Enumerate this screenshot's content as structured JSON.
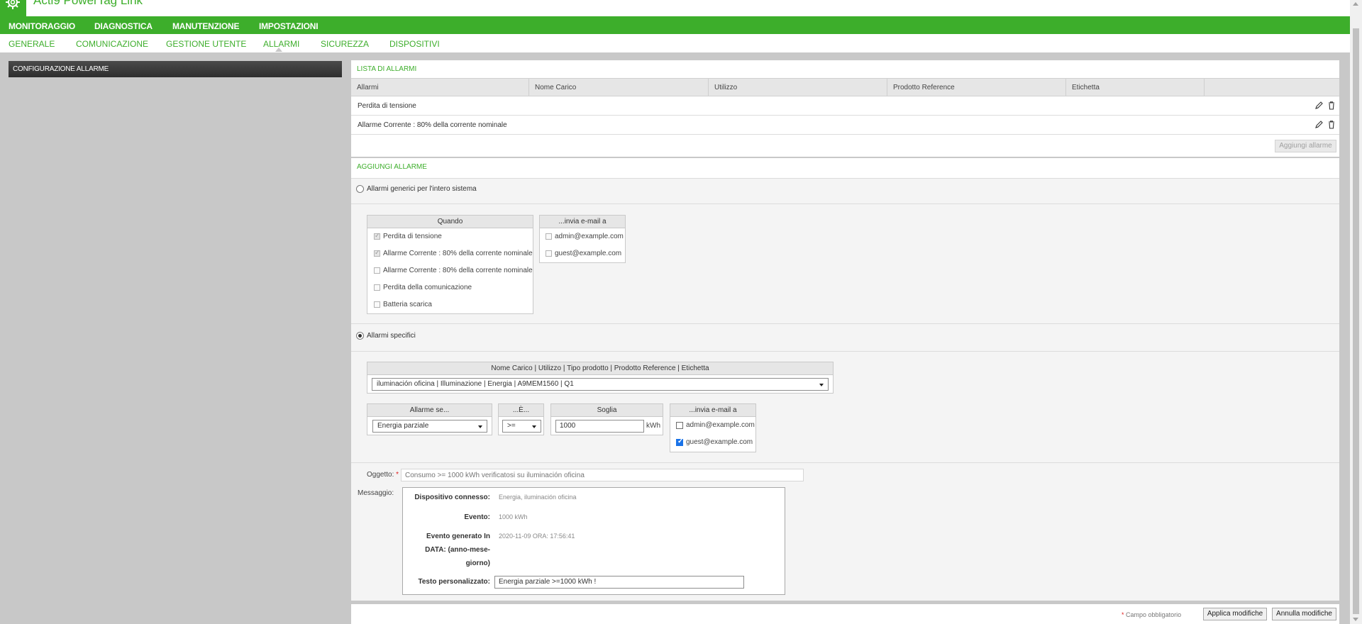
{
  "app": {
    "title": "Acti9 PowerTag Link",
    "logo_icon": "gear-icon"
  },
  "main_nav": [
    {
      "label": "MONITORAGGIO"
    },
    {
      "label": "DIAGNOSTICA"
    },
    {
      "label": "MANUTENZIONE"
    },
    {
      "label": "IMPOSTAZIONI",
      "active": true
    }
  ],
  "sub_nav": [
    {
      "label": "GENERALE"
    },
    {
      "label": "COMUNICAZIONE"
    },
    {
      "label": "GESTIONE UTENTE"
    },
    {
      "label": "ALLARMI",
      "active": true
    },
    {
      "label": "SICUREZZA"
    },
    {
      "label": "DISPOSITIVI"
    }
  ],
  "left_panel": {
    "title": "CONFIGURAZIONE ALLARME"
  },
  "alarm_list": {
    "title": "LISTA DI ALLARMI",
    "columns": [
      "Allarmi",
      "Nome Carico",
      "Utilizzo",
      "Prodotto Reference",
      "Etichetta"
    ],
    "rows": [
      {
        "alarm": "Perdita di tensione"
      },
      {
        "alarm": "Allarme Corrente : 80% della corrente nominale"
      }
    ],
    "add_button": "Aggiungi allarme"
  },
  "add_alarm": {
    "title": "AGGIUNGI ALLARME",
    "generic_radio": "Allarmi generici per l'intero sistema",
    "generic_when": {
      "header": "Quando",
      "options": [
        "Perdita di tensione",
        "Allarme Corrente : 80% della corrente nominale",
        "Allarme Corrente : 80% della corrente nominale",
        "Perdita della comunicazione",
        "Batteria scarica"
      ]
    },
    "generic_email": {
      "header": "...invia e-mail a",
      "options": [
        "admin@example.com",
        "guest@example.com"
      ]
    },
    "specific_radio": "Allarmi specifici",
    "device_header": "Nome Carico | Utilizzo | Tipo prodotto | Prodotto Reference | Etichetta",
    "device_selected": "iluminación oficina | Illuminazione | Energia | A9MEM1560 | Q1",
    "condition": {
      "header": "Allarme se...",
      "selected": "Energia parziale"
    },
    "operator": {
      "header": "...È...",
      "selected": ">="
    },
    "threshold": {
      "header": "Soglia",
      "value": "1000",
      "unit": "kWh"
    },
    "specific_email": {
      "header": "...invia e-mail a",
      "options": [
        {
          "label": "admin@example.com",
          "checked": false
        },
        {
          "label": "guest@example.com",
          "checked": true
        }
      ]
    },
    "subject": {
      "label": "Oggetto:",
      "required_mark": "*",
      "placeholder": "Consumo >= 1000 kWh verificatosi su iluminación oficina"
    },
    "message": {
      "label": "Messaggio:",
      "device_label": "Dispositivo connesso:",
      "device_value": "Energia, iluminación oficina",
      "event_label": "Evento:",
      "event_value": "1000 kWh",
      "generated_label_1": "Evento generato In",
      "generated_label_2": "DATA: (anno-mese-",
      "generated_label_3": "giorno)",
      "generated_value": "2020-11-09 ORA: 17:56:41",
      "custom_label": "Testo personalizzato:",
      "custom_value": "Energia parziale >=1000 kWh !"
    }
  },
  "footer": {
    "required_note_mark": "*",
    "required_note": "Campo obbligatorio",
    "apply_button": "Applica modifiche",
    "cancel_button": "Annulla modifiche"
  },
  "colors": {
    "brand_green": "#3dae2b",
    "dark_header": "#3a3a3a",
    "background": "#c8c8c8"
  }
}
